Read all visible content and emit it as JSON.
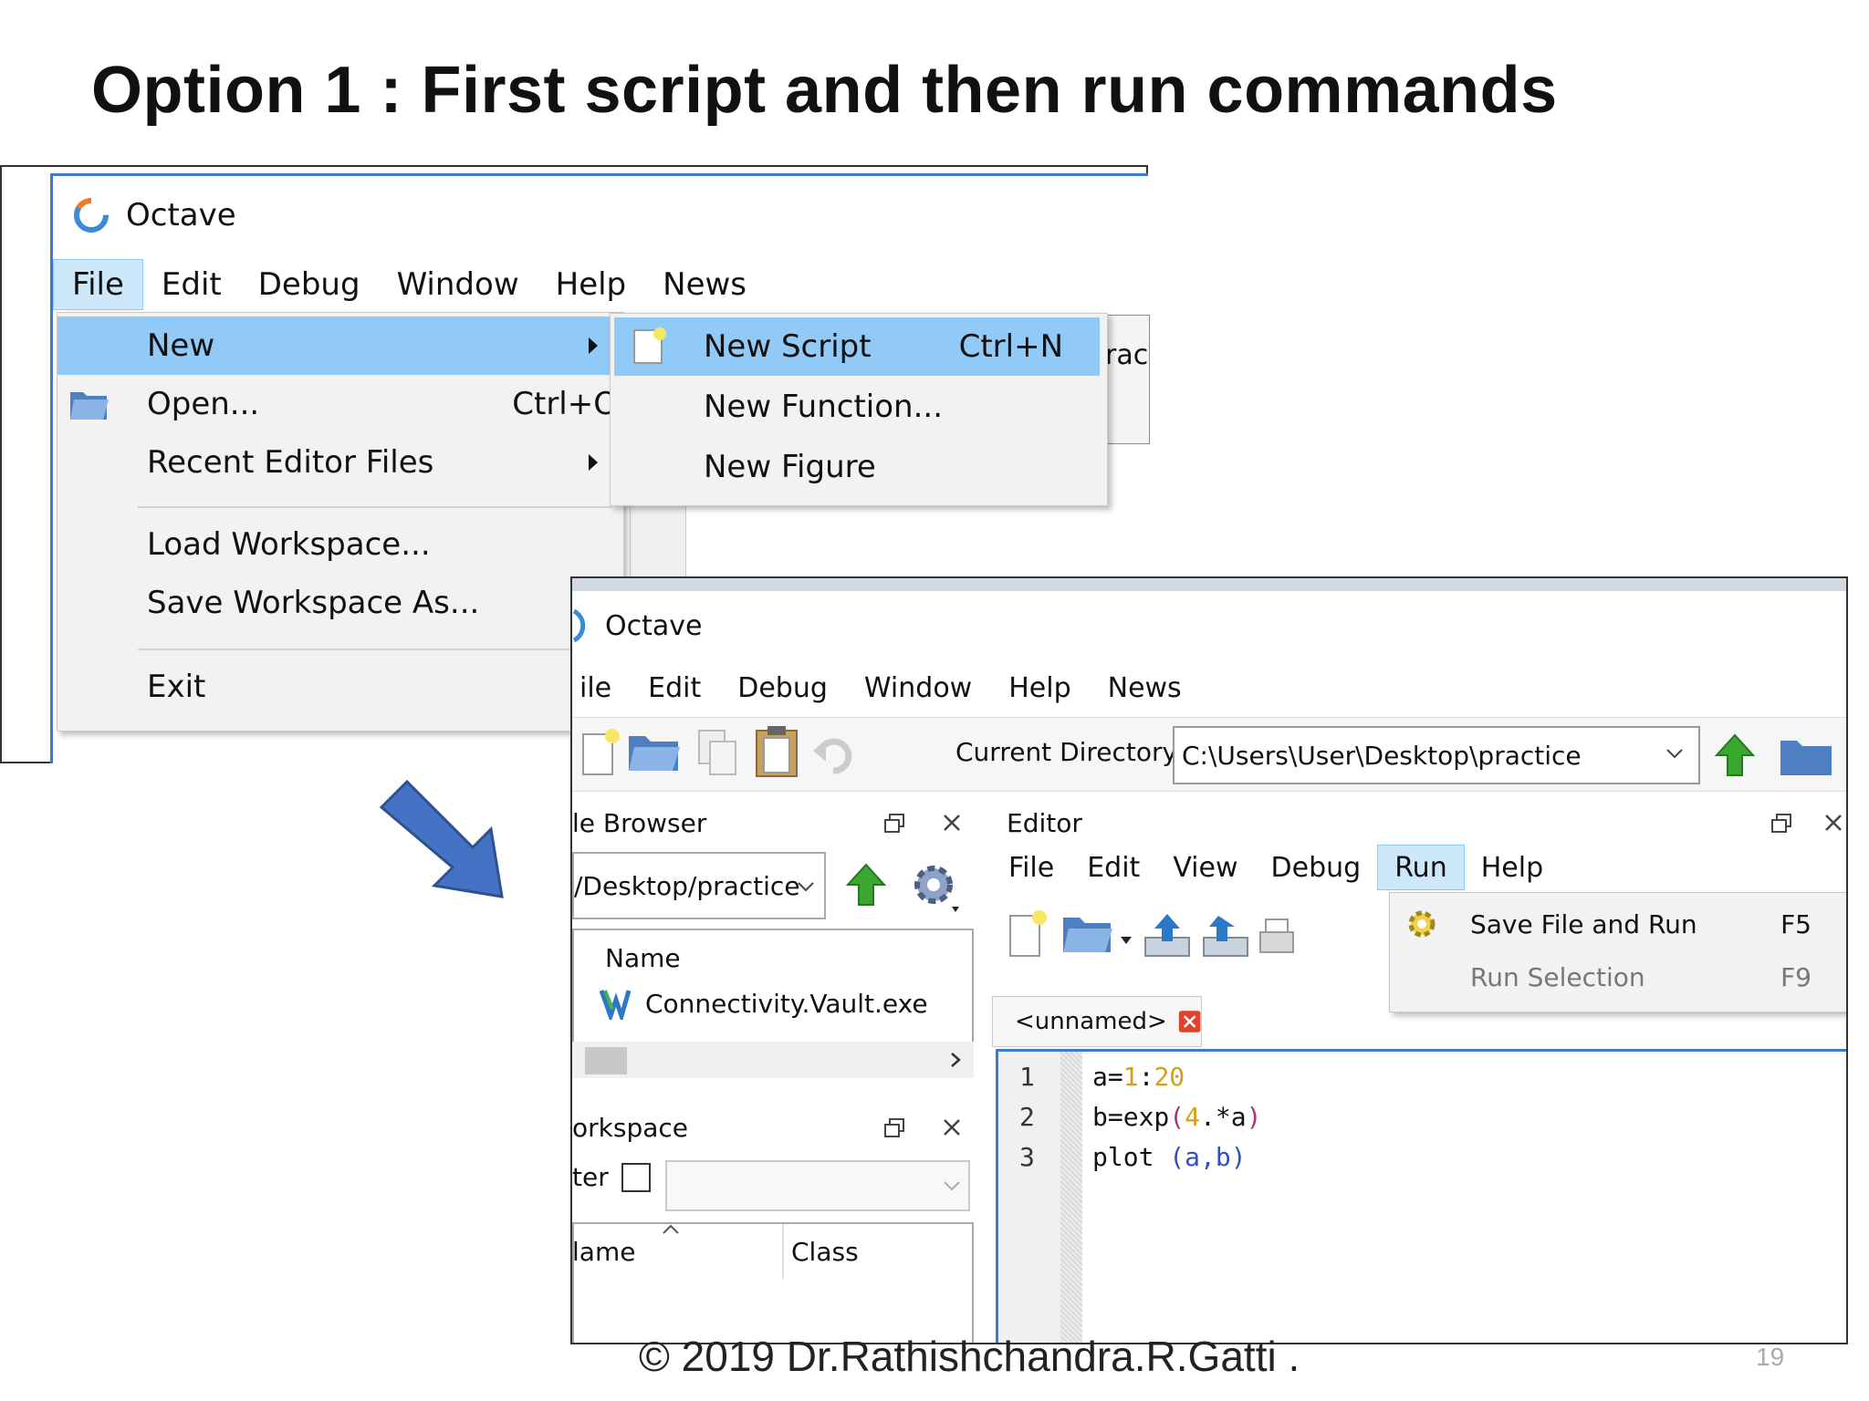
{
  "slide": {
    "title": "Option 1 : First script and then run commands",
    "footer": "© 2019 Dr.Rathishchandra.R.Gatti .",
    "page_number": "19"
  },
  "window1": {
    "app_title": "Octave",
    "menubar": [
      "File",
      "Edit",
      "Debug",
      "Window",
      "Help",
      "News"
    ],
    "active_menu": "File",
    "file_menu": {
      "items": [
        {
          "label": "New",
          "shortcut": "",
          "submenu": true
        },
        {
          "label": "Open...",
          "shortcut": "Ctrl+O",
          "submenu": false
        },
        {
          "label": "Recent Editor Files",
          "shortcut": "",
          "submenu": true
        },
        {
          "label": "Load Workspace...",
          "shortcut": "",
          "submenu": false
        },
        {
          "label": "Save Workspace As...",
          "shortcut": "",
          "submenu": false
        },
        {
          "label": "Exit",
          "shortcut": "",
          "submenu": false
        }
      ]
    },
    "new_submenu": {
      "items": [
        {
          "label": "New Script",
          "shortcut": "Ctrl+N"
        },
        {
          "label": "New Function...",
          "shortcut": ""
        },
        {
          "label": "New Figure",
          "shortcut": ""
        }
      ]
    },
    "partial_text": "rac"
  },
  "window2": {
    "app_title": "Octave",
    "menubar": [
      "ile",
      "Edit",
      "Debug",
      "Window",
      "Help",
      "News"
    ],
    "current_directory_label": "Current Directory:",
    "current_directory": "C:\\Users\\User\\Desktop\\practice",
    "file_browser": {
      "title": "le Browser",
      "path": "/Desktop/practice",
      "column_name": "Name",
      "files": [
        "Connectivity.Vault.exe"
      ]
    },
    "workspace": {
      "title": "orkspace",
      "filter_label": "ter",
      "col_name": "lame",
      "col_class": "Class"
    },
    "editor": {
      "title": "Editor",
      "menubar": [
        "File",
        "Edit",
        "View",
        "Debug",
        "Run",
        "Help"
      ],
      "active_menu": "Run",
      "tab_label": "<unnamed>",
      "lines": [
        {
          "num": "1",
          "code": "a=1:20"
        },
        {
          "num": "2",
          "code": "b=exp(4.*a)"
        },
        {
          "num": "3",
          "code": "plot (a,b)"
        }
      ],
      "run_menu": {
        "items": [
          {
            "label": "Save File and Run",
            "shortcut": "F5",
            "enabled": true
          },
          {
            "label": "Run Selection",
            "shortcut": "F9",
            "enabled": false
          }
        ]
      }
    }
  },
  "colors": {
    "menu_highlight": "#91c9f7",
    "window_border": "#3b78d8",
    "arrow": "#4472c4"
  }
}
